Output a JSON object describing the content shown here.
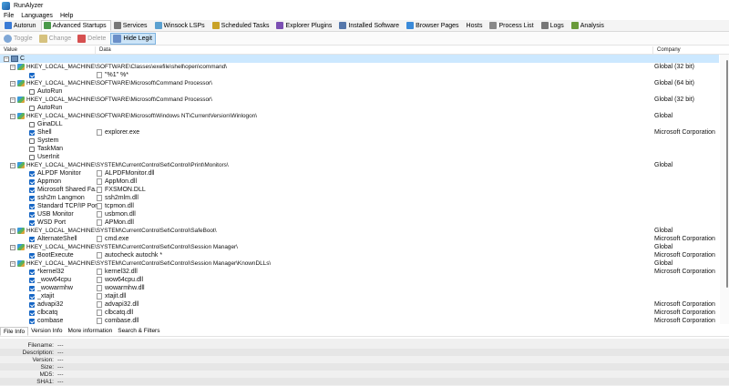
{
  "window": {
    "title": "RunAlyzer"
  },
  "menu": [
    "File",
    "Languages",
    "Help"
  ],
  "tabs": [
    {
      "label": "Autorun",
      "icon": "autorun-icon",
      "color": "#3a7bd5"
    },
    {
      "label": "Advanced Startups",
      "icon": "advanced-startups-icon",
      "color": "#4a9a4a"
    },
    {
      "label": "Services",
      "icon": "gear-icon",
      "color": "#777777"
    },
    {
      "label": "Winsock LSPs",
      "icon": "network-icon",
      "color": "#5aa0d0"
    },
    {
      "label": "Scheduled Tasks",
      "icon": "clock-icon",
      "color": "#c9a227"
    },
    {
      "label": "Explorer Plugins",
      "icon": "puzzle-icon",
      "color": "#7b4fb3"
    },
    {
      "label": "Installed Software",
      "icon": "package-icon",
      "color": "#5577aa"
    },
    {
      "label": "Browser Pages",
      "icon": "browser-icon",
      "color": "#3a8ad9"
    },
    {
      "label": "Hosts",
      "icon": "",
      "color": ""
    },
    {
      "label": "Process List",
      "icon": "process-icon",
      "color": "#888888"
    },
    {
      "label": "Logs",
      "icon": "log-icon",
      "color": "#777777"
    },
    {
      "label": "Analysis",
      "icon": "analysis-icon",
      "color": "#6a9a3a"
    }
  ],
  "active_tab": "Advanced Startups",
  "toolbar": {
    "toggle": "Toggle",
    "change": "Change",
    "delete": "Delete",
    "hide_legit": "Hide Legit"
  },
  "columns": {
    "value": "Value",
    "data": "Data",
    "company": "Company"
  },
  "tree": {
    "root_label": "C",
    "groups": [
      {
        "key": "HKEY_LOCAL_MACHINE\\SOFTWARE\\Classes\\exefile\\shell\\open\\command\\",
        "company": "Global (32 bit)",
        "items": [
          {
            "name": "",
            "data": "\"%1\" %*",
            "checked": true,
            "company": ""
          }
        ]
      },
      {
        "key": "HKEY_LOCAL_MACHINE\\SOFTWARE\\Microsoft\\Command Processor\\",
        "company": "Global (64 bit)",
        "items": [
          {
            "name": "AutoRun",
            "data": "",
            "checked": false,
            "company": ""
          }
        ]
      },
      {
        "key": "HKEY_LOCAL_MACHINE\\SOFTWARE\\Microsoft\\Command Processor\\",
        "company": "Global (32 bit)",
        "items": [
          {
            "name": "AutoRun",
            "data": "",
            "checked": false,
            "company": ""
          }
        ]
      },
      {
        "key": "HKEY_LOCAL_MACHINE\\SOFTWARE\\Microsoft\\Windows NT\\CurrentVersion\\Winlogon\\",
        "company": "Global",
        "items": [
          {
            "name": "GinaDLL",
            "data": "",
            "checked": false,
            "company": ""
          },
          {
            "name": "Shell",
            "data": "explorer.exe",
            "checked": true,
            "company": "Microsoft Corporation"
          },
          {
            "name": "System",
            "data": "",
            "checked": false,
            "company": ""
          },
          {
            "name": "TaskMan",
            "data": "",
            "checked": false,
            "company": ""
          },
          {
            "name": "UserInit",
            "data": "",
            "checked": false,
            "company": ""
          }
        ]
      },
      {
        "key": "HKEY_LOCAL_MACHINE\\SYSTEM\\CurrentControlSet\\Control\\Print\\Monitors\\",
        "company": "Global",
        "items": [
          {
            "name": "ALPDF Monitor",
            "data": "ALPDFMonitor.dll",
            "checked": true,
            "company": ""
          },
          {
            "name": "Appmon",
            "data": "AppMon.dll",
            "checked": true,
            "company": ""
          },
          {
            "name": "Microsoft Shared Fa...",
            "data": "FXSMON.DLL",
            "checked": true,
            "company": ""
          },
          {
            "name": "ssh2m Langmon",
            "data": "ssh2mlm.dll",
            "checked": true,
            "company": ""
          },
          {
            "name": "Standard TCP/IP Port",
            "data": "tcpmon.dll",
            "checked": true,
            "company": ""
          },
          {
            "name": "USB Monitor",
            "data": "usbmon.dll",
            "checked": true,
            "company": ""
          },
          {
            "name": "WSD Port",
            "data": "APMon.dll",
            "checked": true,
            "company": ""
          }
        ]
      },
      {
        "key": "HKEY_LOCAL_MACHINE\\SYSTEM\\CurrentControlSet\\Control\\SafeBoot\\",
        "company": "Global",
        "items": [
          {
            "name": "AlternateShell",
            "data": "cmd.exe",
            "checked": true,
            "company": "Microsoft Corporation"
          }
        ]
      },
      {
        "key": "HKEY_LOCAL_MACHINE\\SYSTEM\\CurrentControlSet\\Control\\Session Manager\\",
        "company": "Global",
        "items": [
          {
            "name": "BootExecute",
            "data": "autocheck autochk *",
            "checked": true,
            "company": "Microsoft Corporation"
          }
        ]
      },
      {
        "key": "HKEY_LOCAL_MACHINE\\SYSTEM\\CurrentControlSet\\Control\\Session Manager\\KnownDLLs\\",
        "company": "Global",
        "items": [
          {
            "name": "*kernel32",
            "data": "kernel32.dll",
            "checked": true,
            "company": "Microsoft Corporation"
          },
          {
            "name": "_wow64cpu",
            "data": "wow64cpu.dll",
            "checked": true,
            "company": ""
          },
          {
            "name": "_wowarmhw",
            "data": "wowarmhw.dll",
            "checked": true,
            "company": ""
          },
          {
            "name": "_xtajit",
            "data": "xtajit.dll",
            "checked": true,
            "company": ""
          },
          {
            "name": "advapi32",
            "data": "advapi32.dll",
            "checked": true,
            "company": "Microsoft Corporation"
          },
          {
            "name": "clbcatq",
            "data": "clbcatq.dll",
            "checked": true,
            "company": "Microsoft Corporation"
          },
          {
            "name": "combase",
            "data": "combase.dll",
            "checked": true,
            "company": "Microsoft Corporation"
          }
        ]
      }
    ]
  },
  "bottom_tabs": [
    "File Info",
    "Version Info",
    "More information",
    "Search & Filters"
  ],
  "file_info": [
    {
      "label": "Filename:",
      "value": "---"
    },
    {
      "label": "Description:",
      "value": "---"
    },
    {
      "label": "Version:",
      "value": "---"
    },
    {
      "label": "Size:",
      "value": "---"
    },
    {
      "label": "MD5:",
      "value": "---"
    },
    {
      "label": "SHA1:",
      "value": "---"
    }
  ]
}
